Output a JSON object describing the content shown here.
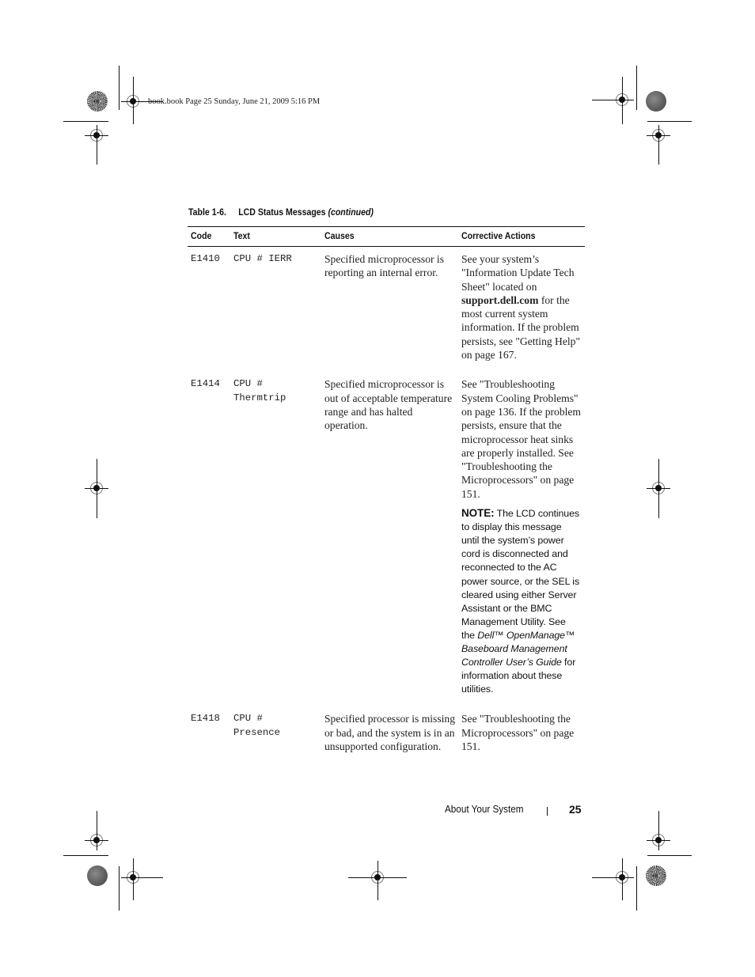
{
  "print_header": {
    "text": "book.book  Page 25  Sunday, June 21, 2009  5:16 PM"
  },
  "table": {
    "caption_number": "Table 1-6.",
    "caption_title": "LCD Status Messages",
    "caption_continued": "(continued)",
    "columns": [
      "Code",
      "Text",
      "Causes",
      "Corrective Actions"
    ],
    "rows": [
      {
        "code": "E1410",
        "text": "CPU # IERR",
        "causes": "Specified microprocessor is reporting an internal error.",
        "actions_pre": "See your system’s \"Information Update Tech Sheet\" located on ",
        "actions_bold": "support.dell.com",
        "actions_post": " for the most current system information. If the problem persists, see \"Getting Help\" on page 167."
      },
      {
        "code": "E1414",
        "text": "CPU # Thermtrip",
        "causes": "Specified microprocessor is out of acceptable temperature range and has halted operation.",
        "actions": "See \"Troubleshooting System Cooling Problems\" on page 136. If the problem persists, ensure that the microprocessor heat sinks are properly installed. See \"Troubleshooting the Microprocessors\" on page 151.",
        "note_label": "NOTE:",
        "note_pre": " The LCD continues to display this message until the system’s power cord is disconnected and reconnected to the AC power source, or the SEL is cleared using either Server Assistant or the BMC Management Utility. See the ",
        "note_italic": "Dell™ OpenManage™ Baseboard Management Controller User’s Guide",
        "note_post": " for information about these utilities."
      },
      {
        "code": "E1418",
        "text": "CPU # Presence",
        "causes": "Specified processor is missing or bad, and the system is in an unsupported configuration.",
        "actions": "See \"Troubleshooting the Microprocessors\" on page 151."
      }
    ]
  },
  "footer": {
    "section_title": "About Your System",
    "page_number": "25"
  }
}
